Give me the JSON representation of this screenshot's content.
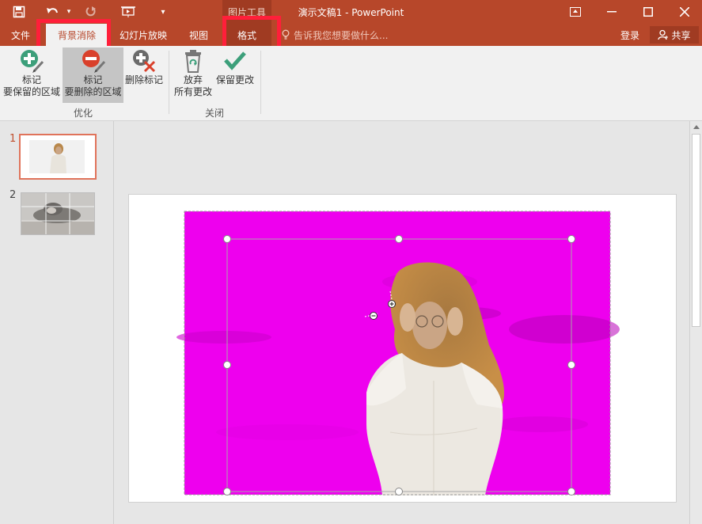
{
  "titlebar": {
    "context_tool": "图片工具",
    "doc_title": "演示文稿1 - PowerPoint"
  },
  "tabs": [
    {
      "label": "文件"
    },
    {
      "label": "背景消除"
    },
    {
      "label": "幻灯片放映"
    },
    {
      "label": "视图"
    },
    {
      "label": "格式"
    }
  ],
  "tell_me": "告诉我您想要做什么...",
  "account": {
    "login": "登录",
    "share": "共享"
  },
  "ribbon": {
    "groups": [
      {
        "label": "优化",
        "buttons": [
          {
            "line1": "标记",
            "line2": "要保留的区域",
            "icon": "mark-keep-icon"
          },
          {
            "line1": "标记",
            "line2": "要删除的区域",
            "icon": "mark-remove-icon"
          },
          {
            "line1": "删除标记",
            "line2": "",
            "icon": "delete-mark-icon"
          }
        ]
      },
      {
        "label": "关闭",
        "buttons": [
          {
            "line1": "放弃",
            "line2": "所有更改",
            "icon": "discard-icon"
          },
          {
            "line1": "保留更改",
            "line2": "",
            "icon": "keep-changes-icon"
          }
        ]
      }
    ]
  },
  "slides": [
    {
      "number": "1"
    },
    {
      "number": "2"
    }
  ],
  "colors": {
    "accent": "#b7472a",
    "removal_overlay": "#ee00ee",
    "highlight": "#ff1f3a"
  }
}
